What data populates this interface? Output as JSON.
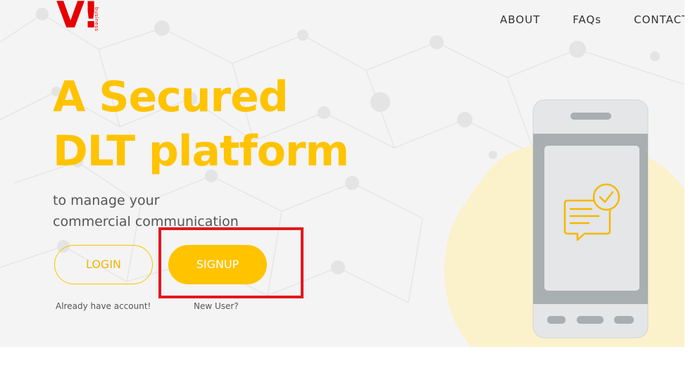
{
  "brand": {
    "logo_text": "V!",
    "sub_text": "business"
  },
  "nav": {
    "items": [
      "ABOUT",
      "FAQs",
      "CONTACT"
    ]
  },
  "hero": {
    "headline_lines": [
      "A Secured",
      "DLT platform"
    ],
    "subtext_lines": [
      "to manage your",
      "commercial communication"
    ]
  },
  "actions": {
    "login_label": "LOGIN",
    "signup_label": "SIGNUP",
    "login_caption": "Already have account!",
    "signup_caption": "New User?"
  },
  "colors": {
    "accent": "#ffc300",
    "brand": "#e60000",
    "highlight": "#e3181f",
    "phone": "#a9aeb1"
  },
  "icons": [
    "phone-illustration",
    "chat-check-icon"
  ]
}
